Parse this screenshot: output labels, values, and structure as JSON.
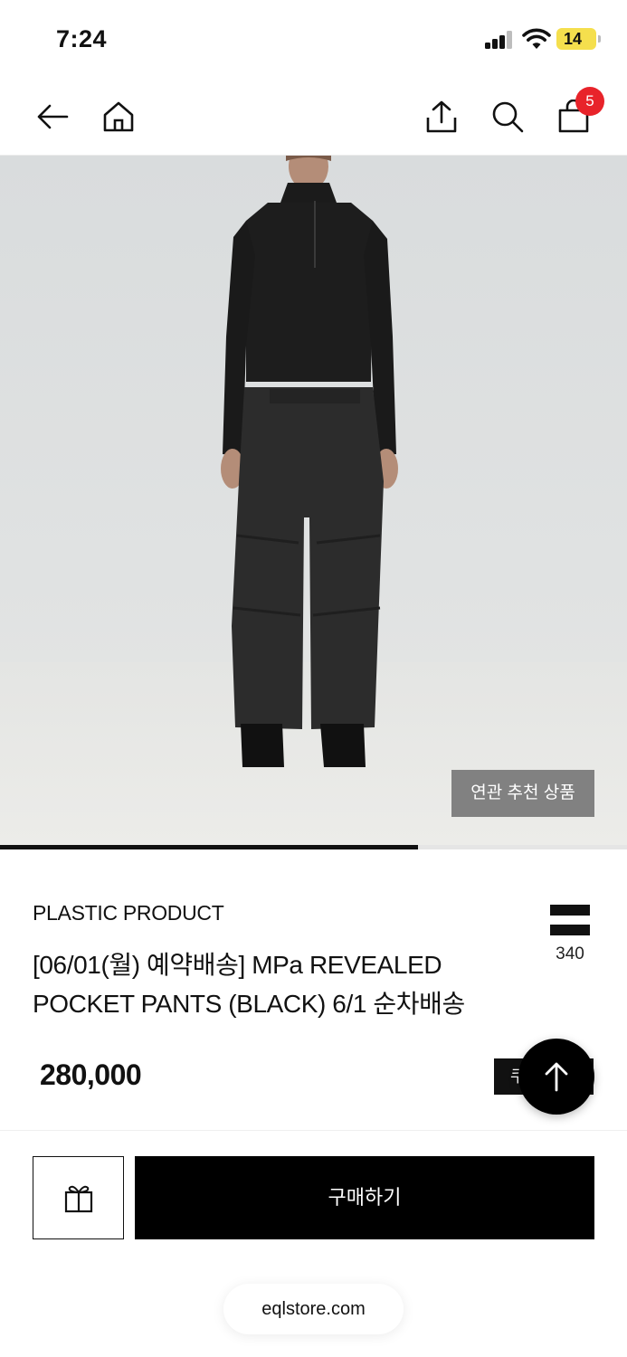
{
  "status_bar": {
    "time": "7:24",
    "battery": "14",
    "battery_color": "#f5df4d"
  },
  "nav": {
    "icons": [
      "back-arrow-icon",
      "home-icon",
      "share-icon",
      "search-icon",
      "shopping-bag-icon"
    ],
    "cart_count": "5",
    "badge_color": "#e8232a"
  },
  "gallery": {
    "related_label": "연관 추천 상품",
    "progress_fraction": 0.667
  },
  "product": {
    "brand": "PLASTIC PRODUCT",
    "title_line1": "[06/01(월) 예약배송]  MPa REVEALED",
    "title_line2": "POCKET PANTS (BLACK) 6/1 순차배송",
    "like_count": "340",
    "price": "280,000",
    "coupon_label": "쿠"
  },
  "bottom": {
    "gift_icon": "gift-icon",
    "buy_label": "구매하기",
    "url": "eqlstore.com"
  }
}
